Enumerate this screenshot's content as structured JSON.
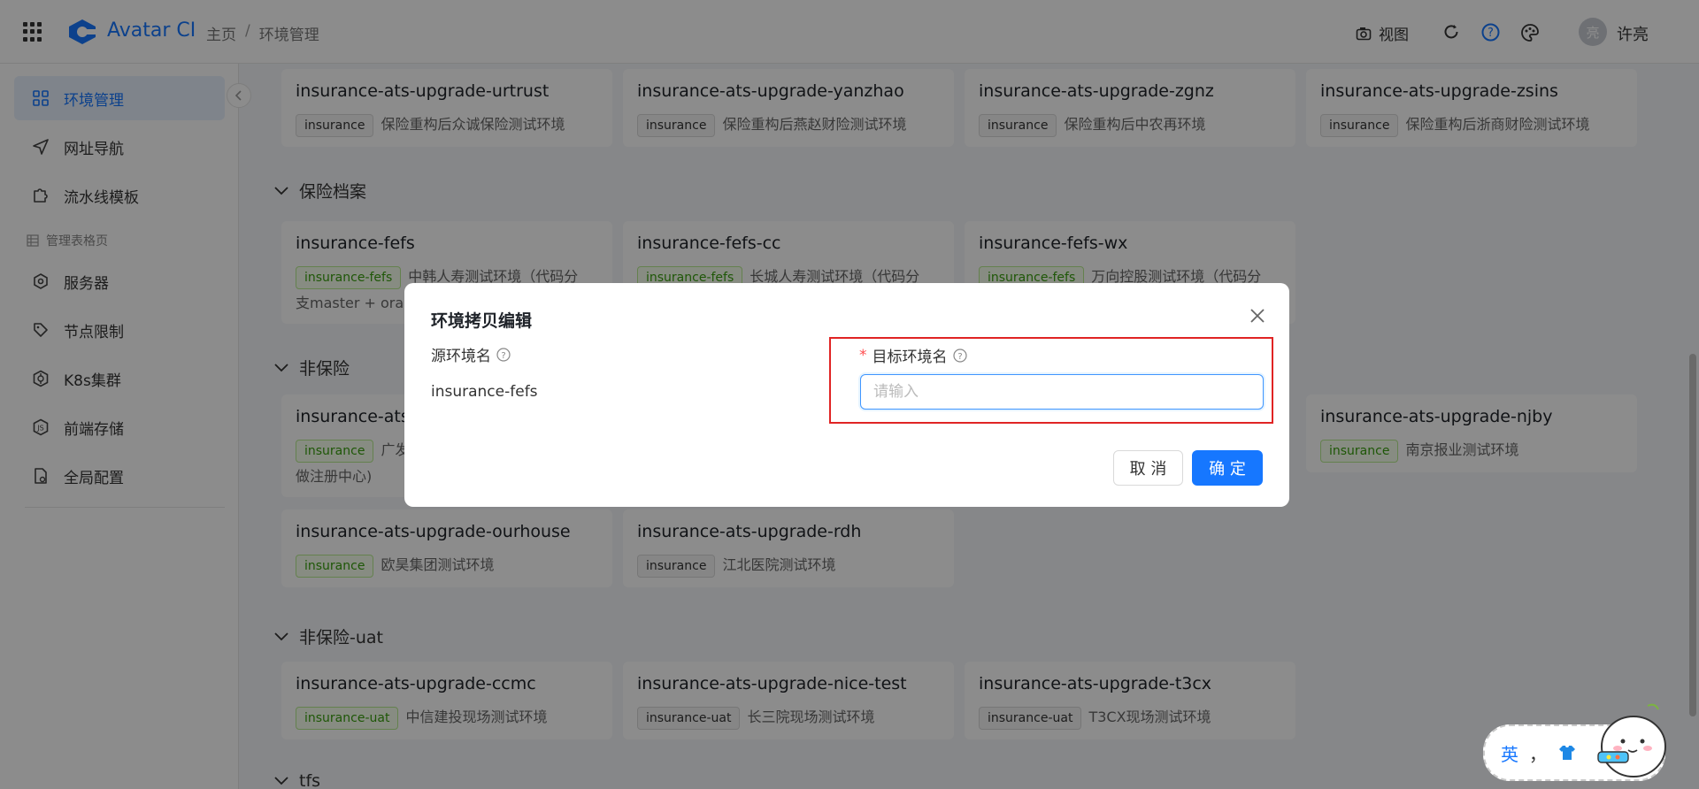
{
  "header": {
    "app_title": "Avatar CI",
    "breadcrumb": [
      "主页",
      "环境管理"
    ],
    "breadcrumb_sep": "/",
    "view_label": "视图",
    "user_avatar_text": "亮",
    "username": "许亮",
    "accent_color": "#1677ff"
  },
  "sidebar": {
    "items": [
      {
        "label": "环境管理",
        "icon": "grid-icon"
      },
      {
        "label": "网址导航",
        "icon": "send-icon"
      },
      {
        "label": "流水线模板",
        "icon": "puzzle-icon"
      }
    ],
    "group_label": "管理表格页",
    "group_items": [
      {
        "label": "服务器",
        "icon": "server-icon"
      },
      {
        "label": "节点限制",
        "icon": "tag-icon"
      },
      {
        "label": "K8s集群",
        "icon": "k8s-icon"
      },
      {
        "label": "前端存储",
        "icon": "storage-icon"
      },
      {
        "label": "全局配置",
        "icon": "config-icon"
      }
    ]
  },
  "main": {
    "top_cards": [
      {
        "title": "insurance-ats-upgrade-urtrust",
        "tag": "insurance",
        "desc": "保险重构后众诚保险测试环境"
      },
      {
        "title": "insurance-ats-upgrade-yanzhao",
        "tag": "insurance",
        "desc": "保险重构后燕赵财险测试环境"
      },
      {
        "title": "insurance-ats-upgrade-zgnz",
        "tag": "insurance",
        "desc": "保险重构后中农再环境"
      },
      {
        "title": "insurance-ats-upgrade-zsins",
        "tag": "insurance",
        "desc": "保险重构后浙商财险测试环境"
      }
    ],
    "section_archive": {
      "title": "保险档案",
      "cards": [
        {
          "title": "insurance-fefs",
          "tag": "insurance-fefs",
          "desc": "中韩人寿测试环境（代码分",
          "desc2": "支master + orac"
        },
        {
          "title": "insurance-fefs-cc",
          "tag": "insurance-fefs",
          "desc": "长城人寿测试环境（代码分"
        },
        {
          "title": "insurance-fefs-wx",
          "tag": "insurance-fefs",
          "desc": "万向控股测试环境（代码分"
        }
      ]
    },
    "section_non": {
      "title": "非保险",
      "cards": [
        {
          "title": "insurance-ats",
          "tag": "insurance",
          "desc": "广发",
          "desc2": "做注册中心)"
        },
        {
          "title": "insurance-ats-upgrade-njby",
          "tag": "insurance",
          "desc": "南京报业测试环境"
        },
        {
          "title": "insurance-ats-upgrade-ourhouse",
          "tag": "insurance",
          "desc": "欧昊集团测试环境"
        },
        {
          "title": "insurance-ats-upgrade-rdh",
          "tag": "insurance",
          "desc": "江北医院测试环境"
        }
      ]
    },
    "section_uat": {
      "title": "非保险-uat",
      "cards": [
        {
          "title": "insurance-ats-upgrade-ccmc",
          "tag": "insurance-uat",
          "desc": "中信建投现场测试环境"
        },
        {
          "title": "insurance-ats-upgrade-nice-test",
          "tag": "insurance-uat",
          "desc": "长三院现场测试环境"
        },
        {
          "title": "insurance-ats-upgrade-t3cx",
          "tag": "insurance-uat",
          "desc": "T3CX现场测试环境"
        }
      ]
    },
    "section_next": {
      "title": "tfs"
    }
  },
  "modal": {
    "title": "环境拷贝编辑",
    "source_label": "源环境名",
    "source_value": "insurance-fefs",
    "required_mark": "*",
    "target_label": "目标环境名",
    "target_placeholder": "请输入",
    "target_value": "",
    "cancel_label": "取 消",
    "ok_label": "确 定"
  },
  "ime": {
    "label": "英",
    "punct": "，"
  }
}
